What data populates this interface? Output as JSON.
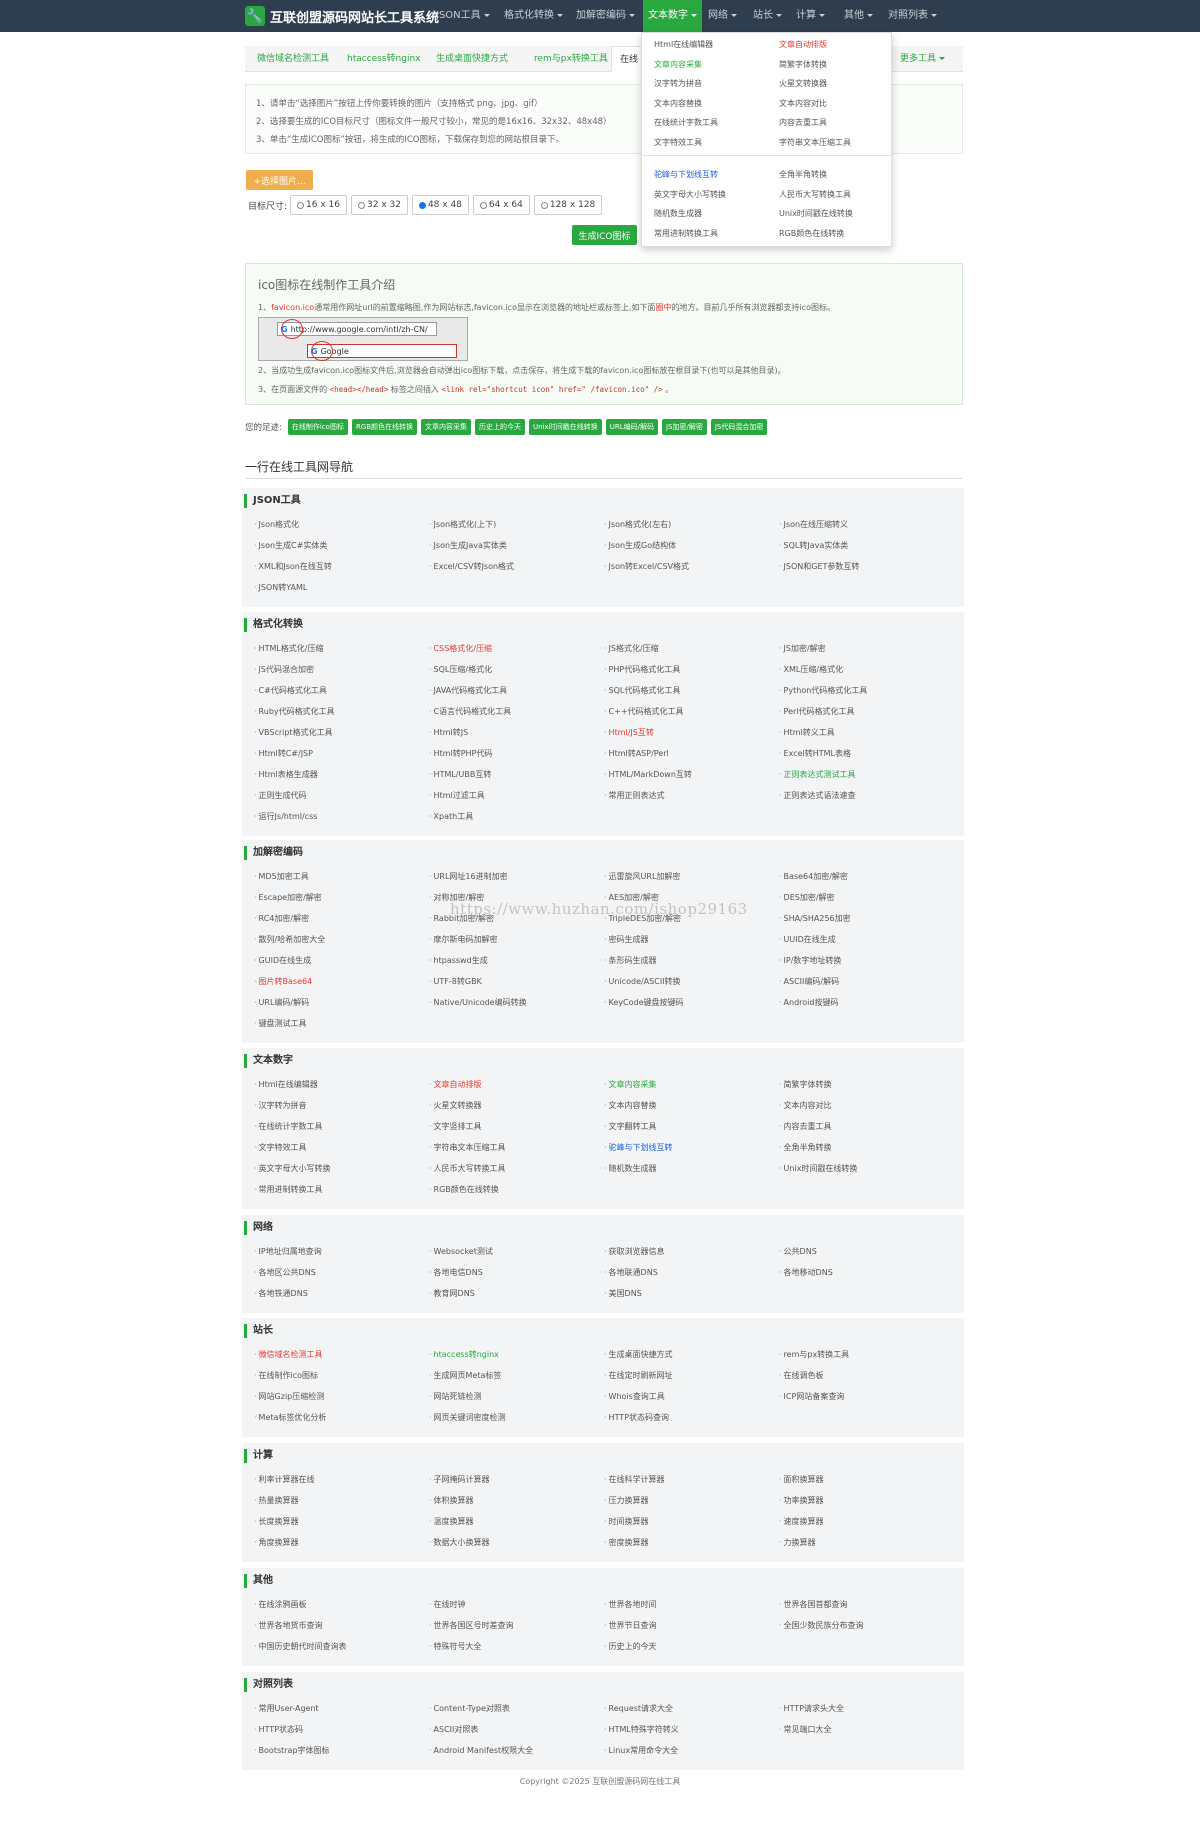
{
  "brand": {
    "icon": "wrench-icon",
    "name": "互联创盟源码网站长工具系统"
  },
  "nav": [
    {
      "label": "JSON工具",
      "active": false
    },
    {
      "label": "格式化转换",
      "active": false
    },
    {
      "label": "加解密编码",
      "active": false
    },
    {
      "label": "文本数字",
      "active": true
    },
    {
      "label": "网络",
      "active": false
    },
    {
      "label": "站长",
      "active": false
    },
    {
      "label": "计算",
      "active": false
    },
    {
      "label": "其他",
      "active": false
    },
    {
      "label": "对照列表",
      "active": false
    }
  ],
  "tabs": [
    {
      "label": "微信域名检测工具"
    },
    {
      "label": "htaccess转nginx"
    },
    {
      "label": "生成桌面快捷方式"
    },
    {
      "label": "rem与px转换工具"
    },
    {
      "label": "在线"
    },
    {
      "label": "更多工具"
    }
  ],
  "steps": [
    "1、请单击“选择图片”按钮上传你要转换的图片（支持格式 png、jpg、gif）",
    "2、选择要生成的ICO目标尺寸（图标文件一般尺寸较小，常见的是16x16、32x32、48x48）",
    "3、单击“生成ICO图标”按钮，将生成的ICO图标，下载保存到您的网站根目录下。"
  ],
  "upload_label": "+选择图片...",
  "size_label": "目标尺寸:",
  "sizes": [
    {
      "label": "16 x 16",
      "checked": false
    },
    {
      "label": "32 x 32",
      "checked": false
    },
    {
      "label": "48 x 48",
      "checked": true
    },
    {
      "label": "64 x 64",
      "checked": false
    },
    {
      "label": "128 x 128",
      "checked": false
    }
  ],
  "generate_label": "生成ICO图标",
  "intro": {
    "title": "ico图标在线制作工具介绍",
    "line1_prefix": "1、",
    "line1_hl": "favicon.ico",
    "line1_text": "通常用作网址url的前置缩略图,作为网站标志,favicon.ico显示在浏览器的地址栏或标签上,如下面",
    "line1_hl2": "圈中",
    "line1_tail": "的地方。目前几乎所有浏览器都支持ico图标。",
    "address_url": "http://www.google.com/intl/zh-CN/",
    "tab_text": "Google",
    "line2": "2、当成功生成favicon.ico图标文件后,浏览器会自动弹出ico图标下载，点击保存，将生成下载的favicon.ico图标放在根目录下(也可以是其他目录)。",
    "line3_prefix": "3、在页面源文件的",
    "line3_code1": "<head></head>",
    "line3_mid": "标签之间插入",
    "line3_code2": "<link rel=\"shortcut icon\" href=\" /favicon.ico\" />",
    "line3_tail": "。"
  },
  "footprint": {
    "label": "您的足迹:",
    "tags": [
      "在线制作ico图标",
      "RGB颜色在线转换",
      "文章内容采集",
      "历史上的今天",
      "Unix时间戳在线转换",
      "URL编码/解码",
      "JS加密/解密",
      "JS代码混合加密"
    ]
  },
  "nav_title": "一行在线工具网导航",
  "sections": [
    {
      "title": "JSON工具",
      "links": [
        {
          "t": "Json格式化",
          "c": ""
        },
        {
          "t": "Json格式化(上下)",
          "c": ""
        },
        {
          "t": "Json格式化(左右)",
          "c": ""
        },
        {
          "t": "Json在线压缩转义",
          "c": ""
        },
        {
          "t": "Json生成C#实体类",
          "c": ""
        },
        {
          "t": "Json生成Java实体类",
          "c": ""
        },
        {
          "t": "Json生成Go结构体",
          "c": ""
        },
        {
          "t": "SQL转Java实体类",
          "c": ""
        },
        {
          "t": "XML和Json在线互转",
          "c": ""
        },
        {
          "t": "Excel/CSV转Json格式",
          "c": ""
        },
        {
          "t": "Json转Excel/CSV格式",
          "c": ""
        },
        {
          "t": "JSON和GET参数互转",
          "c": ""
        },
        {
          "t": "JSON转YAML",
          "c": ""
        }
      ]
    },
    {
      "title": "格式化转换",
      "links": [
        {
          "t": "HTML格式化/压缩",
          "c": ""
        },
        {
          "t": "CSS格式化/压缩",
          "c": "red"
        },
        {
          "t": "JS格式化/压缩",
          "c": ""
        },
        {
          "t": "JS加密/解密",
          "c": ""
        },
        {
          "t": "JS代码混合加密",
          "c": ""
        },
        {
          "t": "SQL压缩/格式化",
          "c": ""
        },
        {
          "t": "PHP代码格式化工具",
          "c": ""
        },
        {
          "t": "XML压缩/格式化",
          "c": ""
        },
        {
          "t": "C#代码格式化工具",
          "c": ""
        },
        {
          "t": "JAVA代码格式化工具",
          "c": ""
        },
        {
          "t": "SQL代码格式化工具",
          "c": ""
        },
        {
          "t": "Python代码格式化工具",
          "c": ""
        },
        {
          "t": "Ruby代码格式化工具",
          "c": ""
        },
        {
          "t": "C语言代码格式化工具",
          "c": ""
        },
        {
          "t": "C++代码格式化工具",
          "c": ""
        },
        {
          "t": "Perl代码格式化工具",
          "c": ""
        },
        {
          "t": "VBScript格式化工具",
          "c": ""
        },
        {
          "t": "Html转JS",
          "c": ""
        },
        {
          "t": "Html/JS互转",
          "c": "red"
        },
        {
          "t": "Html转义工具",
          "c": ""
        },
        {
          "t": "Html转C#/JSP",
          "c": ""
        },
        {
          "t": "Html转PHP代码",
          "c": ""
        },
        {
          "t": "Html转ASP/Perl",
          "c": ""
        },
        {
          "t": "Excel转HTML表格",
          "c": ""
        },
        {
          "t": "Html表格生成器",
          "c": ""
        },
        {
          "t": "HTML/UBB互转",
          "c": ""
        },
        {
          "t": "HTML/MarkDown互转",
          "c": ""
        },
        {
          "t": "正则表达式测试工具",
          "c": "green"
        },
        {
          "t": "正则生成代码",
          "c": ""
        },
        {
          "t": "Html过滤工具",
          "c": ""
        },
        {
          "t": "常用正则表达式",
          "c": ""
        },
        {
          "t": "正则表达式语法速查",
          "c": ""
        },
        {
          "t": "运行Js/html/css",
          "c": ""
        },
        {
          "t": "Xpath工具",
          "c": ""
        }
      ]
    },
    {
      "title": "加解密编码",
      "links": [
        {
          "t": "MD5加密工具",
          "c": ""
        },
        {
          "t": "URL网址16进制加密",
          "c": ""
        },
        {
          "t": "迅雷旋风URL加解密",
          "c": ""
        },
        {
          "t": "Base64加密/解密",
          "c": ""
        },
        {
          "t": "Escape加密/解密",
          "c": ""
        },
        {
          "t": "对称加密/解密",
          "c": ""
        },
        {
          "t": "AES加密/解密",
          "c": ""
        },
        {
          "t": "DES加密/解密",
          "c": ""
        },
        {
          "t": "RC4加密/解密",
          "c": ""
        },
        {
          "t": "Rabbit加密/解密",
          "c": ""
        },
        {
          "t": "TripleDES加密/解密",
          "c": ""
        },
        {
          "t": "SHA/SHA256加密",
          "c": ""
        },
        {
          "t": "散列/哈希加密大全",
          "c": ""
        },
        {
          "t": "摩尔斯电码加解密",
          "c": ""
        },
        {
          "t": "密码生成器",
          "c": ""
        },
        {
          "t": "UUID在线生成",
          "c": ""
        },
        {
          "t": "GUID在线生成",
          "c": ""
        },
        {
          "t": "htpasswd生成",
          "c": ""
        },
        {
          "t": "条形码生成器",
          "c": ""
        },
        {
          "t": "IP/数字地址转换",
          "c": ""
        },
        {
          "t": "图片转Base64",
          "c": "red"
        },
        {
          "t": "UTF-8转GBK",
          "c": ""
        },
        {
          "t": "Unicode/ASCII转换",
          "c": ""
        },
        {
          "t": "ASCII编码/解码",
          "c": ""
        },
        {
          "t": "URL编码/解码",
          "c": ""
        },
        {
          "t": "Native/Unicode编码转换",
          "c": ""
        },
        {
          "t": "KeyCode键盘按键码",
          "c": ""
        },
        {
          "t": "Android按键码",
          "c": ""
        },
        {
          "t": "键盘测试工具",
          "c": ""
        }
      ]
    },
    {
      "title": "文本数字",
      "links": [
        {
          "t": "Html在线编辑器",
          "c": ""
        },
        {
          "t": "文章自动排版",
          "c": "red"
        },
        {
          "t": "文章内容采集",
          "c": "green"
        },
        {
          "t": "简繁字体转换",
          "c": ""
        },
        {
          "t": "汉字转为拼音",
          "c": ""
        },
        {
          "t": "火星文转换器",
          "c": ""
        },
        {
          "t": "文本内容替换",
          "c": ""
        },
        {
          "t": "文本内容对比",
          "c": ""
        },
        {
          "t": "在线统计字数工具",
          "c": ""
        },
        {
          "t": "文字竖排工具",
          "c": ""
        },
        {
          "t": "文字翻转工具",
          "c": ""
        },
        {
          "t": "内容去重工具",
          "c": ""
        },
        {
          "t": "文字特效工具",
          "c": ""
        },
        {
          "t": "字符串文本压缩工具",
          "c": ""
        },
        {
          "t": "驼峰与下划线互转",
          "c": "blue"
        },
        {
          "t": "全角半角转换",
          "c": ""
        },
        {
          "t": "英文字母大小写转换",
          "c": ""
        },
        {
          "t": "人民币大写转换工具",
          "c": ""
        },
        {
          "t": "随机数生成器",
          "c": ""
        },
        {
          "t": "Unix时间戳在线转换",
          "c": ""
        },
        {
          "t": "常用进制转换工具",
          "c": ""
        },
        {
          "t": "RGB颜色在线转换",
          "c": ""
        }
      ]
    },
    {
      "title": "网络",
      "links": [
        {
          "t": "IP地址归属地查询",
          "c": ""
        },
        {
          "t": "Websocket测试",
          "c": ""
        },
        {
          "t": "获取浏览器信息",
          "c": ""
        },
        {
          "t": "公共DNS",
          "c": ""
        },
        {
          "t": "各地区公共DNS",
          "c": ""
        },
        {
          "t": "各地电信DNS",
          "c": ""
        },
        {
          "t": "各地联通DNS",
          "c": ""
        },
        {
          "t": "各地移动DNS",
          "c": ""
        },
        {
          "t": "各地铁通DNS",
          "c": ""
        },
        {
          "t": "教育网DNS",
          "c": ""
        },
        {
          "t": "美国DNS",
          "c": ""
        }
      ]
    },
    {
      "title": "站长",
      "links": [
        {
          "t": "微信域名检测工具",
          "c": "red"
        },
        {
          "t": "htaccess转nginx",
          "c": "green"
        },
        {
          "t": "生成桌面快捷方式",
          "c": ""
        },
        {
          "t": "rem与px转换工具",
          "c": ""
        },
        {
          "t": "在线制作ico图标",
          "c": ""
        },
        {
          "t": "生成网页Meta标签",
          "c": ""
        },
        {
          "t": "在线定时刷新网址",
          "c": ""
        },
        {
          "t": "在线调色板",
          "c": ""
        },
        {
          "t": "网站Gzip压缩检测",
          "c": ""
        },
        {
          "t": "网站死链检测",
          "c": ""
        },
        {
          "t": "Whois查询工具",
          "c": ""
        },
        {
          "t": "ICP网站备案查询",
          "c": ""
        },
        {
          "t": "Meta标签优化分析",
          "c": ""
        },
        {
          "t": "网页关键词密度检测",
          "c": ""
        },
        {
          "t": "HTTP状态码查询",
          "c": ""
        }
      ]
    },
    {
      "title": "计算",
      "links": [
        {
          "t": "利率计算器在线",
          "c": ""
        },
        {
          "t": "子网掩码计算器",
          "c": ""
        },
        {
          "t": "在线科学计算器",
          "c": ""
        },
        {
          "t": "面积换算器",
          "c": ""
        },
        {
          "t": "热量换算器",
          "c": ""
        },
        {
          "t": "体积换算器",
          "c": ""
        },
        {
          "t": "压力换算器",
          "c": ""
        },
        {
          "t": "功率换算器",
          "c": ""
        },
        {
          "t": "长度换算器",
          "c": ""
        },
        {
          "t": "温度换算器",
          "c": ""
        },
        {
          "t": "时间换算器",
          "c": ""
        },
        {
          "t": "速度换算器",
          "c": ""
        },
        {
          "t": "角度换算器",
          "c": ""
        },
        {
          "t": "数据大小换算器",
          "c": ""
        },
        {
          "t": "密度换算器",
          "c": ""
        },
        {
          "t": "力换算器",
          "c": ""
        }
      ]
    },
    {
      "title": "其他",
      "links": [
        {
          "t": "在线涂鸦画板",
          "c": ""
        },
        {
          "t": "在线时钟",
          "c": ""
        },
        {
          "t": "世界各地时间",
          "c": ""
        },
        {
          "t": "世界各国首都查询",
          "c": ""
        },
        {
          "t": "世界各地货币查询",
          "c": ""
        },
        {
          "t": "世界各国区号时差查询",
          "c": ""
        },
        {
          "t": "世界节日查询",
          "c": ""
        },
        {
          "t": "全国少数民族分布查询",
          "c": ""
        },
        {
          "t": "中国历史朝代时间查询表",
          "c": ""
        },
        {
          "t": "特殊符号大全",
          "c": ""
        },
        {
          "t": "历史上的今天",
          "c": ""
        }
      ]
    },
    {
      "title": "对照列表",
      "links": [
        {
          "t": "常用User-Agent",
          "c": ""
        },
        {
          "t": "Content-Type对照表",
          "c": ""
        },
        {
          "t": "Request请求大全",
          "c": ""
        },
        {
          "t": "HTTP请求头大全",
          "c": ""
        },
        {
          "t": "HTTP状态码",
          "c": ""
        },
        {
          "t": "ASCII对照表",
          "c": ""
        },
        {
          "t": "HTML特殊字符转义",
          "c": ""
        },
        {
          "t": "常见端口大全",
          "c": ""
        },
        {
          "t": "Bootstrap字体图标",
          "c": ""
        },
        {
          "t": "Android Manifest权限大全",
          "c": ""
        },
        {
          "t": "Linux常用命令大全",
          "c": ""
        }
      ]
    }
  ],
  "dropdown": [
    {
      "t": "Html在线编辑器",
      "c": ""
    },
    {
      "t": "文章自动排版",
      "c": "red"
    },
    {
      "t": "文章内容采集",
      "c": "green"
    },
    {
      "t": "简繁字体转换",
      "c": ""
    },
    {
      "t": "汉字转为拼音",
      "c": ""
    },
    {
      "t": "火星文转换器",
      "c": ""
    },
    {
      "t": "文本内容替换",
      "c": ""
    },
    {
      "t": "文本内容对比",
      "c": ""
    },
    {
      "t": "在线统计字数工具",
      "c": ""
    },
    {
      "t": "内容去重工具",
      "c": ""
    },
    {
      "t": "文字特效工具",
      "c": ""
    },
    {
      "t": "字符串文本压缩工具",
      "c": ""
    },
    {
      "t": "驼峰与下划线互转",
      "c": "blue"
    },
    {
      "t": "全角半角转换",
      "c": ""
    },
    {
      "t": "英文字母大小写转换",
      "c": ""
    },
    {
      "t": "人民币大写转换工具",
      "c": ""
    },
    {
      "t": "随机数生成器",
      "c": ""
    },
    {
      "t": "Unix时间戳在线转换",
      "c": ""
    },
    {
      "t": "常用进制转换工具",
      "c": ""
    },
    {
      "t": "RGB颜色在线转换",
      "c": ""
    }
  ],
  "copyright": "Copyright ©2025 互联创盟源码网在线工具",
  "watermark": "https://www.huzhan.com/ishop29163",
  "colors": {
    "navbar": "#2f3e4f",
    "accent": "#2aa840",
    "orange": "#f0ad4e",
    "red": "#e83a32",
    "blue": "#1a5fe0"
  }
}
